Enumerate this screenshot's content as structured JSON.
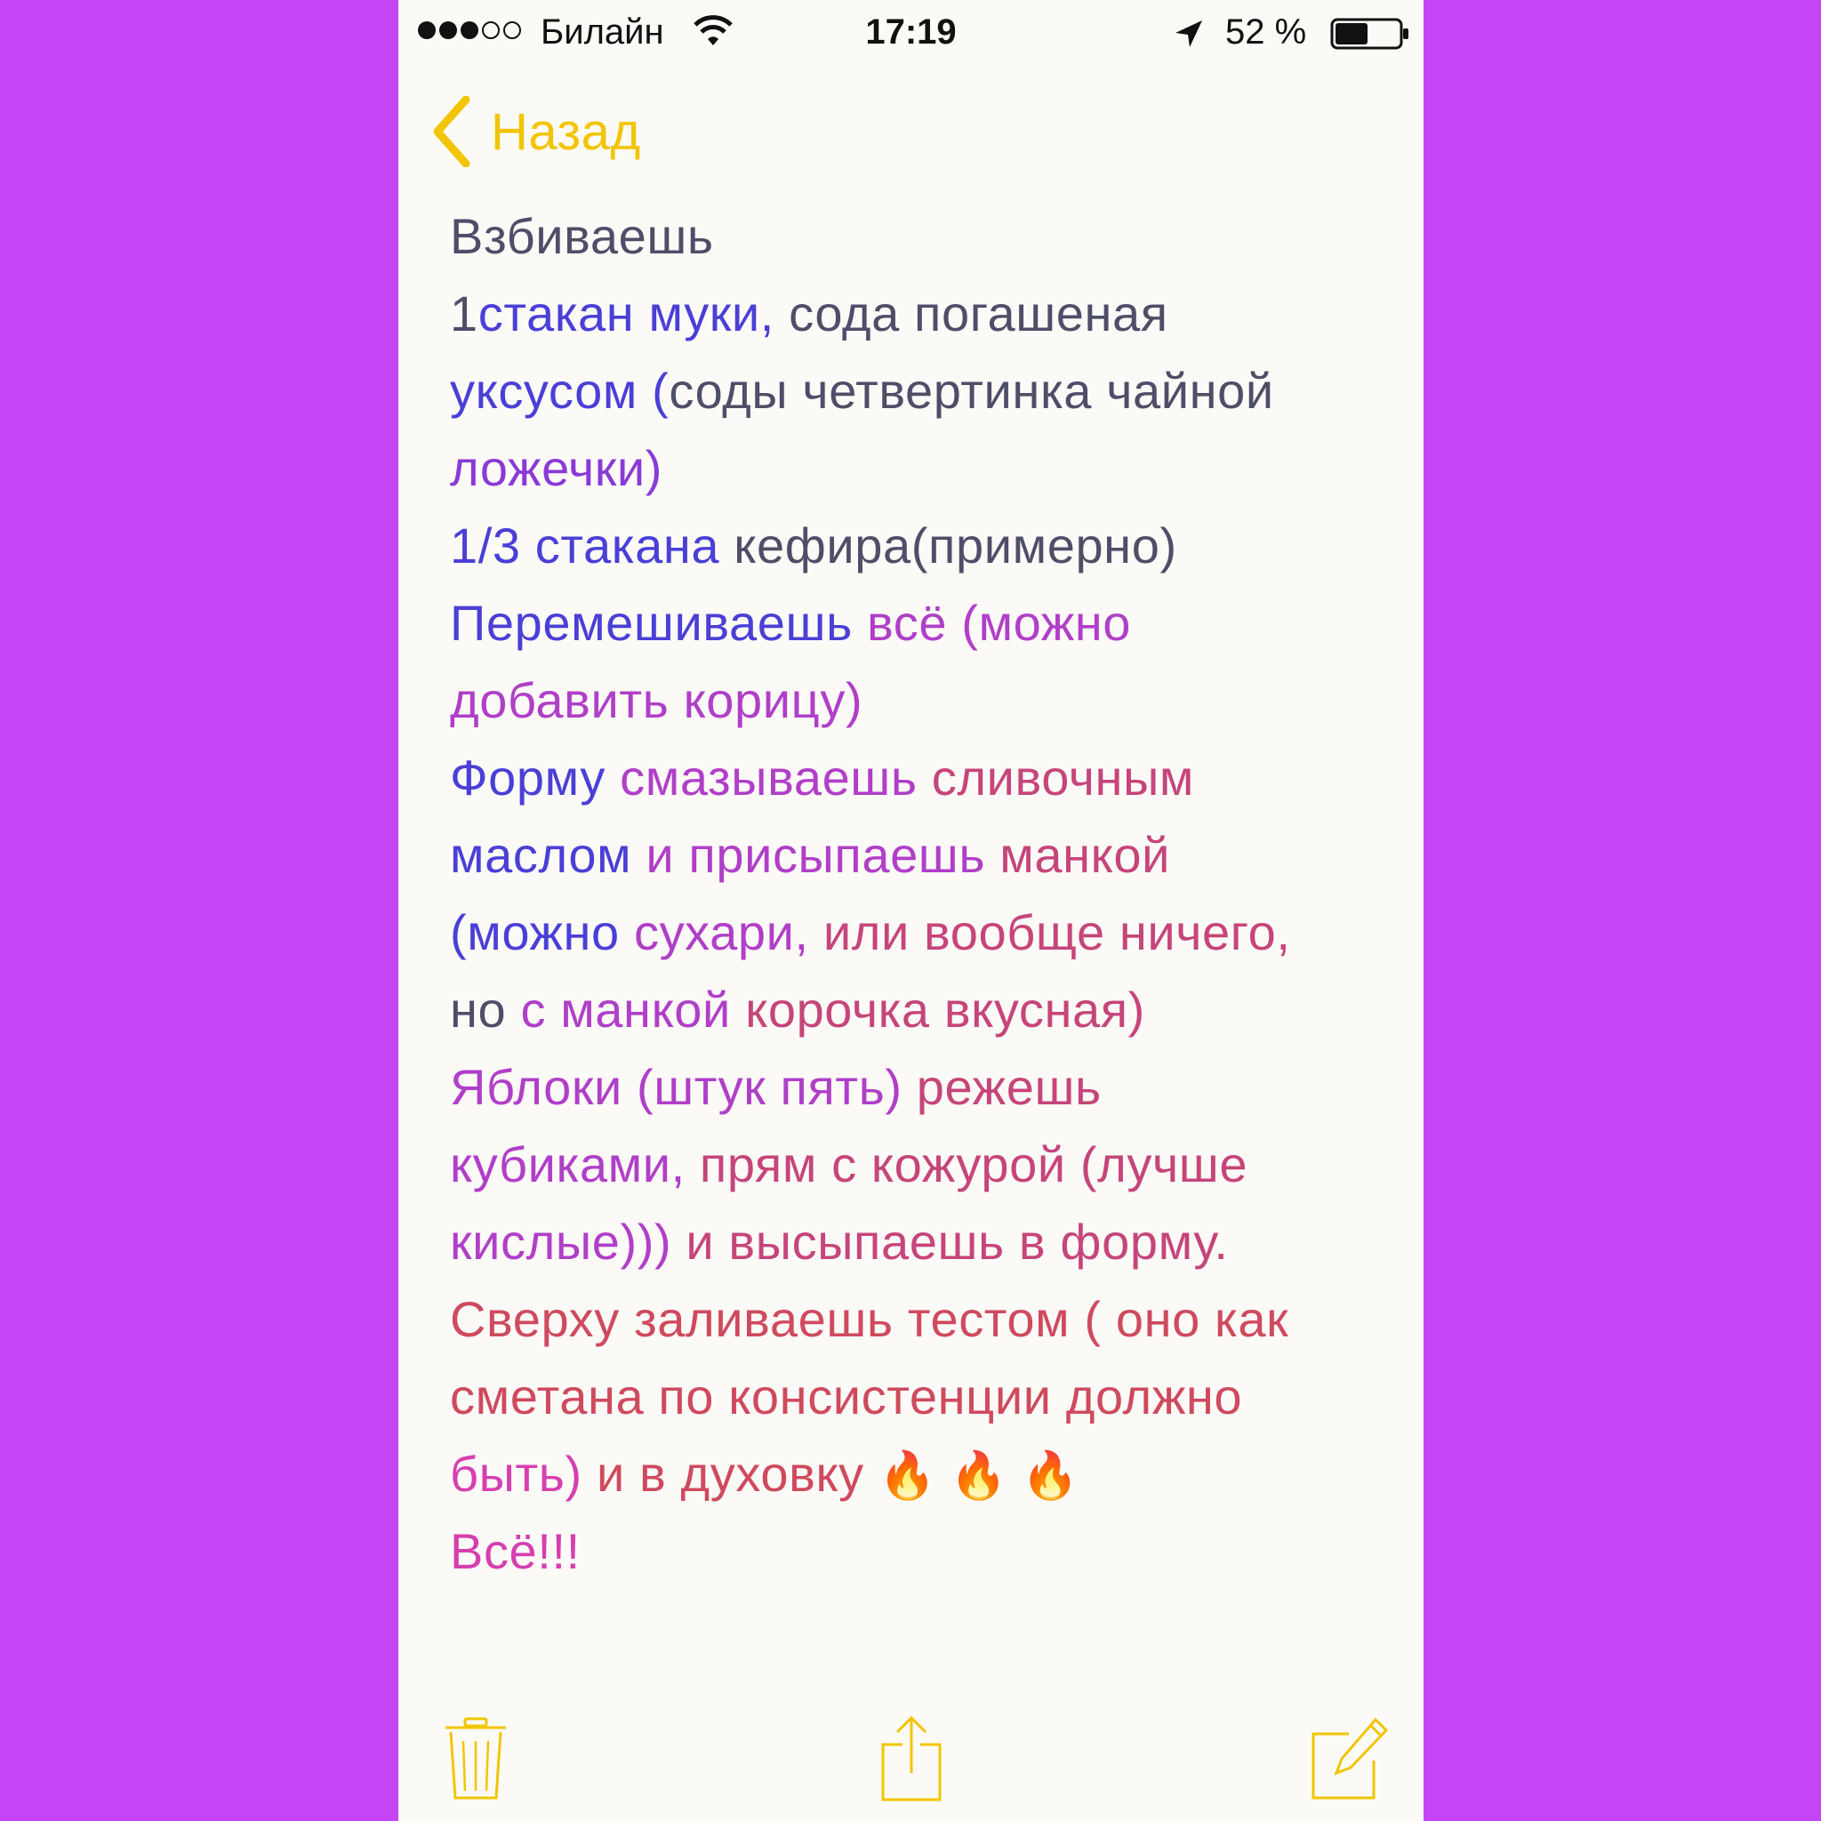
{
  "status_bar": {
    "carrier": "Билайн",
    "time": "17:19",
    "battery_percent": "52 %",
    "battery_level": 0.52,
    "signal_bars": 3,
    "signal_total": 5
  },
  "nav": {
    "back_label": "Назад",
    "accent_color": "#f2c500"
  },
  "note": {
    "lines": [
      [
        {
          "t": "Взбиваешь",
          "c": "gray"
        }
      ],
      [
        {
          "t": "1",
          "c": "gray"
        },
        {
          "t": "стакан муки, ",
          "c": "blue"
        },
        {
          "t": "сода погашеная",
          "c": "gray"
        }
      ],
      [
        {
          "t": "уксусом (",
          "c": "blue"
        },
        {
          "t": "соды четвертинка чайной",
          "c": "gray"
        }
      ],
      [
        {
          "t": "ложечки)",
          "c": "violet"
        }
      ],
      [
        {
          "t": "1/3 стакана ",
          "c": "blue"
        },
        {
          "t": "кефира(примерно)",
          "c": "gray"
        }
      ],
      [
        {
          "t": "Перемешиваешь ",
          "c": "blue"
        },
        {
          "t": "всё (можно",
          "c": "purple"
        }
      ],
      [
        {
          "t": "добавить корицу)",
          "c": "purple"
        }
      ],
      [
        {
          "t": "Форму ",
          "c": "blue"
        },
        {
          "t": "смазываешь ",
          "c": "purple"
        },
        {
          "t": "сливочным",
          "c": "rose"
        }
      ],
      [
        {
          "t": "маслом ",
          "c": "blue"
        },
        {
          "t": "и присыпаешь ",
          "c": "purple"
        },
        {
          "t": "манкой",
          "c": "rose"
        }
      ],
      [
        {
          "t": "(можно ",
          "c": "blue"
        },
        {
          "t": "сухари, ",
          "c": "purple"
        },
        {
          "t": "или вообще ничего,",
          "c": "rose"
        }
      ],
      [
        {
          "t": "но ",
          "c": "gray"
        },
        {
          "t": "с манкой ",
          "c": "purple"
        },
        {
          "t": "корочка вкусная)",
          "c": "rose"
        }
      ],
      [
        {
          "t": "Яблоки (штук пять) ",
          "c": "purple"
        },
        {
          "t": "режешь",
          "c": "rose"
        }
      ],
      [
        {
          "t": "кубиками, ",
          "c": "purple"
        },
        {
          "t": "прям с кожурой (лучше",
          "c": "rose"
        }
      ],
      [
        {
          "t": "кислые))) ",
          "c": "purple"
        },
        {
          "t": "и высыпаешь в форму.",
          "c": "rose"
        }
      ],
      [
        {
          "t": "Сверху заливаешь тестом ( оно как",
          "c": "red"
        }
      ],
      [
        {
          "t": "сметана по консистенции должно",
          "c": "red"
        }
      ],
      [
        {
          "t": "быть) ",
          "c": "pink"
        },
        {
          "t": "и в духовку ",
          "c": "red"
        },
        {
          "t": "🔥 🔥 🔥",
          "c": "emoji"
        }
      ],
      [
        {
          "t": "Всё!!!",
          "c": "pink"
        }
      ]
    ]
  },
  "toolbar": {
    "delete_icon": "trash-icon",
    "share_icon": "share-icon",
    "compose_icon": "compose-icon"
  }
}
